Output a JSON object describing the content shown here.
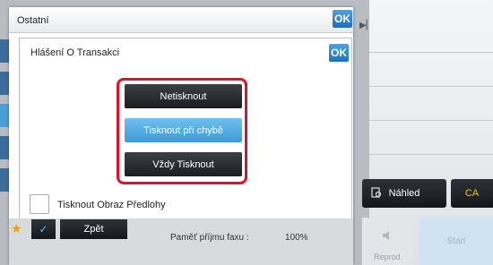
{
  "outer_dialog": {
    "title": "Ostatní",
    "ok_label": "OK"
  },
  "inner_dialog": {
    "title": "Hlášení O Transakci",
    "ok_label": "OK",
    "options": [
      {
        "label": "Netisknout",
        "selected": false
      },
      {
        "label": "Tisknout při chybě",
        "selected": true
      },
      {
        "label": "Vždy Tisknout",
        "selected": false
      }
    ],
    "checkbox": {
      "label": "Tisknout Obraz Předlohy",
      "checked": false
    }
  },
  "right_panel": {
    "preview_label": "Náhled",
    "ca_label": "CA",
    "repro_label": "Reprod.",
    "start_label": "Start"
  },
  "bottom_bar": {
    "back_label": "Zpět",
    "fax_memory_label": "Paměť příjmu faxu :",
    "fax_memory_value": "100%"
  },
  "colors": {
    "highlight": "#e0102f",
    "selected_option": "#4aa8e2",
    "ok_button": "#2a86d0",
    "ca_text": "#f3c400"
  }
}
